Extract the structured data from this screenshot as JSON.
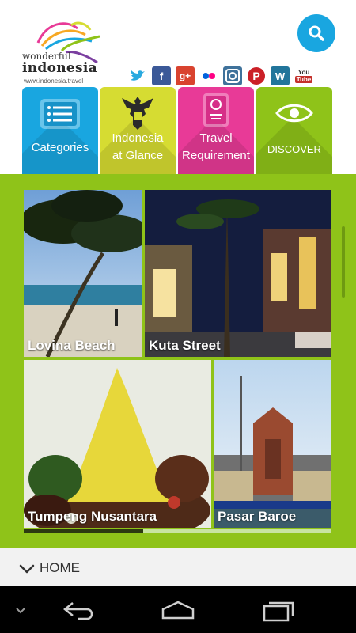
{
  "header": {
    "logo_line1": "wonderful",
    "logo_line2": "indonesia",
    "logo_url": "www.indonesia.travel"
  },
  "socials": [
    {
      "name": "twitter",
      "glyph": "t",
      "color": "#ffffff"
    },
    {
      "name": "facebook",
      "glyph": "f",
      "color": "#3b5998"
    },
    {
      "name": "google-plus",
      "glyph": "g+",
      "color": "#d9432f"
    },
    {
      "name": "flickr",
      "glyph": "••",
      "color": "#ffffff"
    },
    {
      "name": "instagram",
      "glyph": "◎",
      "color": "#3f729b"
    },
    {
      "name": "pinterest",
      "glyph": "P",
      "color": "#cb2027"
    },
    {
      "name": "wordpress",
      "glyph": "W",
      "color": "#21759b"
    },
    {
      "name": "youtube",
      "glyph": "You\nTube",
      "color": "#c4302b"
    }
  ],
  "tabs": [
    {
      "label": "Categories",
      "color": "#19a6e0"
    },
    {
      "label_line1": "Indonesia",
      "label_line2": "at Glance",
      "color": "#d6dc32"
    },
    {
      "label_line1": "Travel",
      "label_line2": "Requirement",
      "color": "#e83a97"
    },
    {
      "label": "DISCOVER",
      "color": "#8fc319"
    }
  ],
  "tiles": [
    {
      "label": "Lovina Beach"
    },
    {
      "label": "Kuta Street"
    },
    {
      "label": "Tumpeng Nusantara"
    },
    {
      "label": "Pasar Baroe"
    }
  ],
  "carousel_progress": 0.39,
  "home": {
    "label": "HOME"
  }
}
